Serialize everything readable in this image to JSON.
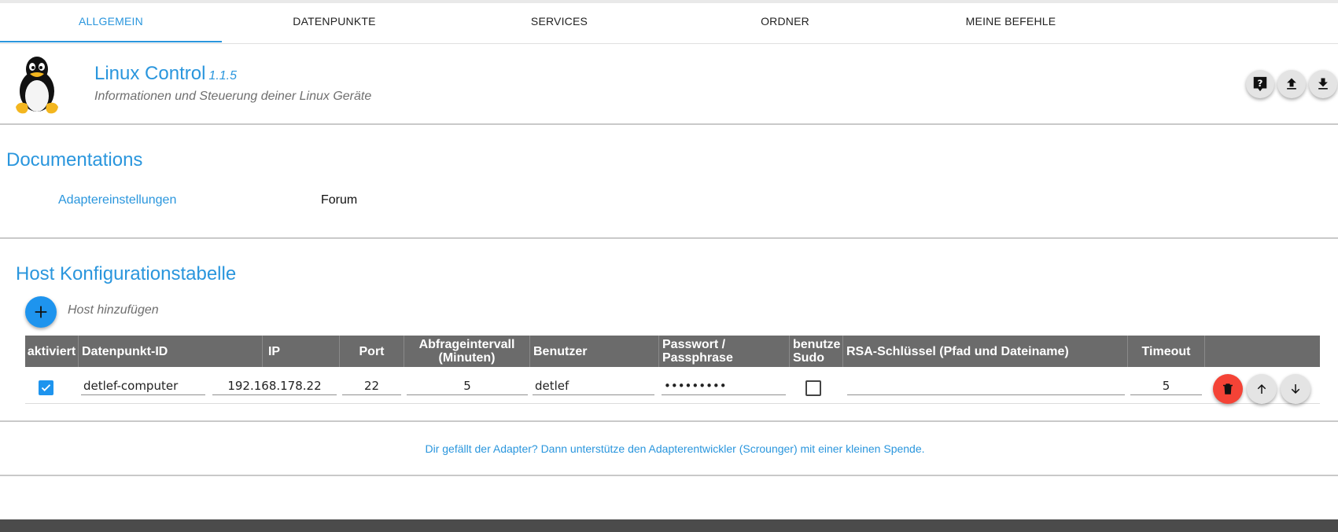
{
  "tabs": [
    {
      "label": "ALLGEMEIN",
      "active": true
    },
    {
      "label": "DATENPUNKTE",
      "active": false
    },
    {
      "label": "SERVICES",
      "active": false
    },
    {
      "label": "ORDNER",
      "active": false
    },
    {
      "label": "MEINE BEFEHLE",
      "active": false
    }
  ],
  "header": {
    "title": "Linux Control",
    "version": "1.1.5",
    "subtitle": "Informationen und Steuerung deiner Linux Geräte",
    "logo_icon": "linux-penguin-icon",
    "buttons": [
      {
        "icon": "help-icon"
      },
      {
        "icon": "upload-icon"
      },
      {
        "icon": "download-icon"
      }
    ]
  },
  "documentation": {
    "title": "Documentations",
    "links": [
      "Adaptereinstellungen",
      "Forum"
    ]
  },
  "hosts": {
    "title": "Host Konfigurationstabelle",
    "add_label": "Host hinzufügen",
    "columns": [
      "aktiviert",
      "Datenpunkt-ID",
      "IP",
      "Port",
      "Abfrageintervall (Minuten)",
      "Benutzer",
      "Passwort / Passphrase",
      "benutze Sudo",
      "RSA-Schlüssel (Pfad und Dateiname)",
      "Timeout",
      ""
    ],
    "rows": [
      {
        "aktiviert": true,
        "datapoint_id": "detlef-computer",
        "ip": "192.168.178.22",
        "port": "22",
        "interval": "5",
        "user": "detlef",
        "password": "•••••••••",
        "sudo": false,
        "rsa_key": "",
        "timeout": "5"
      }
    ]
  },
  "donate_text": "Dir gefällt der Adapter? Dann unterstütze den Adapterentwickler (Scrounger) mit einer kleinen Spende.",
  "colors": {
    "accent": "#2a96dd",
    "add_button": "#1e94ee",
    "delete_button": "#f44336",
    "table_header": "#6b6b6b",
    "footer": "#4b4b4b"
  }
}
